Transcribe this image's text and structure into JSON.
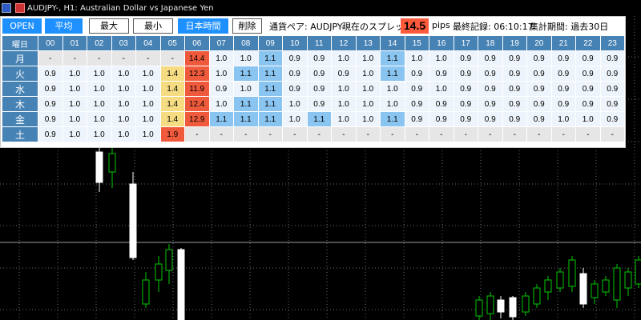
{
  "window": {
    "title": "AUDJPY-, H1:  Australian Dollar vs Japanese Yen"
  },
  "toolbar": {
    "open_label": "OPEN",
    "avg_label": "平均",
    "max_label": "最大",
    "min_label": "最小",
    "jst_label": "日本時間",
    "delete_label": "削除",
    "pair_text": "通貨ペア: AUDJPY-",
    "current_spread_label": "現在のスプレッド:",
    "current_spread_value": "14.5",
    "pips_label": "pips",
    "last_record_text": "最終記録: 06:10:17",
    "period_text": "集計期間: 過去30日"
  },
  "colors": {
    "header_blue": "#4682b4",
    "button_blue": "#1e90ff",
    "cell_light": "#eef4fb",
    "cell_gray": "#e6e6e6",
    "cell_yellow": "#f5dc82",
    "cell_red": "#f05a3c",
    "cell_blue": "#8ac4f0",
    "chart_bg": "#000000",
    "grid": "#c8c8c8",
    "candle_up": "#00c800",
    "candle_down": "#ffffff"
  },
  "table": {
    "corner_label": "曜日",
    "hours": [
      "00",
      "01",
      "02",
      "03",
      "04",
      "05",
      "06",
      "07",
      "08",
      "09",
      "10",
      "11",
      "12",
      "13",
      "14",
      "15",
      "16",
      "17",
      "18",
      "19",
      "20",
      "21",
      "22",
      "23"
    ],
    "rows": [
      {
        "day": "月",
        "values": [
          "-",
          "-",
          "-",
          "-",
          "-",
          "-",
          "14.4",
          "1.0",
          "1.0",
          "1.1",
          "0.9",
          "0.9",
          "1.0",
          "1.0",
          "1.1",
          "1.0",
          "1.0",
          "0.9",
          "0.9",
          "0.9",
          "0.9",
          "0.9",
          "0.9",
          "0.9"
        ],
        "tones": [
          "g",
          "g",
          "g",
          "g",
          "g",
          "g",
          "r",
          "l",
          "l",
          "b",
          "l",
          "l",
          "l",
          "l",
          "b",
          "l",
          "l",
          "l",
          "l",
          "l",
          "l",
          "l",
          "l",
          "l"
        ]
      },
      {
        "day": "火",
        "values": [
          "0.9",
          "1.0",
          "1.0",
          "1.0",
          "1.0",
          "1.4",
          "12.3",
          "1.0",
          "1.1",
          "1.1",
          "0.9",
          "0.9",
          "0.9",
          "1.0",
          "1.1",
          "0.9",
          "0.9",
          "0.9",
          "0.9",
          "0.9",
          "0.9",
          "0.9",
          "0.9",
          "0.9"
        ],
        "tones": [
          "l",
          "l",
          "l",
          "l",
          "l",
          "y",
          "r",
          "l",
          "b",
          "b",
          "l",
          "l",
          "l",
          "l",
          "b",
          "l",
          "l",
          "l",
          "l",
          "l",
          "l",
          "l",
          "l",
          "l"
        ]
      },
      {
        "day": "水",
        "values": [
          "0.9",
          "1.0",
          "1.0",
          "1.0",
          "1.0",
          "1.4",
          "11.9",
          "0.9",
          "1.0",
          "1.1",
          "0.9",
          "0.9",
          "1.0",
          "1.0",
          "1.0",
          "0.9",
          "1.0",
          "0.9",
          "0.9",
          "0.9",
          "0.9",
          "0.9",
          "0.9",
          "0.9"
        ],
        "tones": [
          "l",
          "l",
          "l",
          "l",
          "l",
          "y",
          "r",
          "l",
          "l",
          "b",
          "l",
          "l",
          "l",
          "l",
          "l",
          "l",
          "l",
          "l",
          "l",
          "l",
          "l",
          "l",
          "l",
          "l"
        ]
      },
      {
        "day": "木",
        "values": [
          "0.9",
          "1.0",
          "1.0",
          "1.0",
          "1.0",
          "1.4",
          "12.4",
          "1.0",
          "1.1",
          "1.1",
          "1.0",
          "0.9",
          "1.0",
          "1.0",
          "1.0",
          "0.9",
          "0.9",
          "0.9",
          "0.9",
          "0.9",
          "0.9",
          "0.9",
          "0.9",
          "0.9"
        ],
        "tones": [
          "l",
          "l",
          "l",
          "l",
          "l",
          "y",
          "r",
          "l",
          "b",
          "b",
          "l",
          "l",
          "l",
          "l",
          "l",
          "l",
          "l",
          "l",
          "l",
          "l",
          "l",
          "l",
          "l",
          "l"
        ]
      },
      {
        "day": "金",
        "values": [
          "0.9",
          "1.0",
          "1.0",
          "1.0",
          "1.0",
          "1.4",
          "12.9",
          "1.1",
          "1.1",
          "1.1",
          "1.0",
          "1.1",
          "1.0",
          "1.0",
          "1.1",
          "0.9",
          "0.9",
          "0.9",
          "0.9",
          "0.9",
          "0.9",
          "1.0",
          "1.0",
          "0.9"
        ],
        "tones": [
          "l",
          "l",
          "l",
          "l",
          "l",
          "y",
          "r",
          "b",
          "b",
          "b",
          "l",
          "b",
          "l",
          "l",
          "b",
          "l",
          "l",
          "l",
          "l",
          "l",
          "l",
          "l",
          "l",
          "l"
        ]
      },
      {
        "day": "土",
        "values": [
          "0.9",
          "1.0",
          "1.0",
          "1.0",
          "1.0",
          "1.9",
          "-",
          "-",
          "-",
          "-",
          "-",
          "-",
          "-",
          "-",
          "-",
          "-",
          "-",
          "-",
          "-",
          "-",
          "-",
          "-",
          "-",
          "-"
        ],
        "tones": [
          "l",
          "l",
          "l",
          "l",
          "l",
          "r",
          "g",
          "g",
          "g",
          "g",
          "g",
          "g",
          "g",
          "g",
          "g",
          "g",
          "g",
          "g",
          "g",
          "g",
          "g",
          "g",
          "g",
          "g"
        ]
      }
    ]
  }
}
